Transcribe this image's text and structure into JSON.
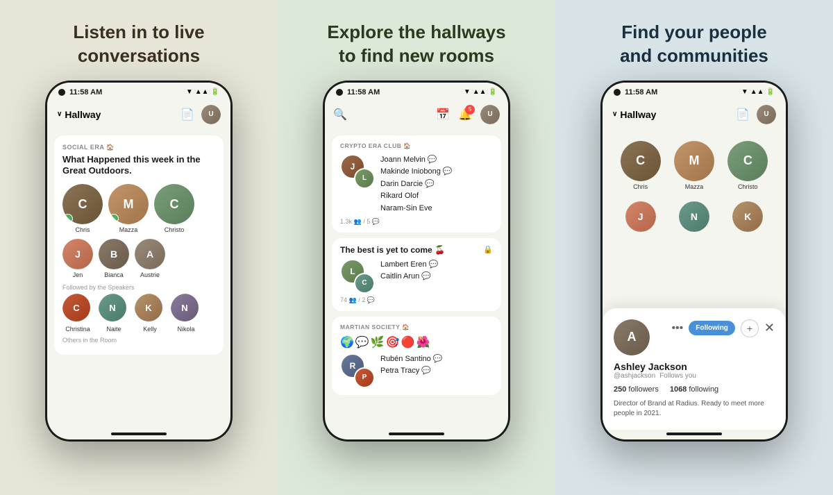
{
  "panel1": {
    "title": "Listen in to live\nconversations",
    "status_time": "11:58 AM",
    "hallway_label": "Hallway",
    "room1": {
      "club_label": "SOCIAL ERA 🏠",
      "title": "What Happened this week in the Great Outdoors.",
      "speakers": [
        {
          "name": "Chris",
          "badge": true,
          "color": "av-chris"
        },
        {
          "name": "Mazza",
          "badge": true,
          "color": "av-mazza"
        },
        {
          "name": "Christo",
          "badge": false,
          "color": "av-christo"
        }
      ],
      "followed_label": "Followed by the Speakers",
      "followers": [
        {
          "name": "Christina",
          "color": "av-christina"
        },
        {
          "name": "Naite",
          "color": "av-naite"
        },
        {
          "name": "Kelly",
          "color": "av-kelly"
        },
        {
          "name": "Nikola",
          "color": "av-nikola"
        }
      ],
      "others_label": "Others in the Room",
      "row2": [
        {
          "name": "Jen",
          "color": "av-jen"
        },
        {
          "name": "Bianca",
          "color": "av-bianca"
        },
        {
          "name": "Austrie",
          "color": "av-austrie"
        }
      ]
    }
  },
  "panel2": {
    "title": "Explore the hallways\nto find new rooms",
    "status_time": "11:58 AM",
    "search_placeholder": "Search",
    "notif_count": "5",
    "rooms": [
      {
        "club_label": "CRYPTO ERA CLUB 🏠",
        "speakers": [
          "Joann Melvin",
          "Makinde Iniobong",
          "Darin Darcie",
          "Rikard Olof",
          "Naram-Sin Eve"
        ],
        "meta": "1.3k 👥 / 5 💬"
      },
      {
        "title": "The best is yet to come 🍒",
        "locked": true,
        "speakers": [
          "Lambert Eren",
          "Caitlin Arun"
        ],
        "meta": "74 👥 / 2 💬"
      },
      {
        "club_label": "MARTIAN SOCIETY 🏠",
        "emoji_row": [
          "🌍",
          "💬",
          "🌿",
          "🎯",
          "🔴",
          "🌺"
        ],
        "speakers": [
          "Rubén Santino",
          "Petra Tracy"
        ],
        "meta": ""
      }
    ]
  },
  "panel3": {
    "title": "Find your people\nand communities",
    "status_time": "11:58 AM",
    "hallway_label": "Hallway",
    "speakers": [
      {
        "name": "Chris",
        "color": "av-chris"
      },
      {
        "name": "Mazza",
        "color": "av-mazza"
      },
      {
        "name": "Christo",
        "color": "av-christo"
      }
    ],
    "profile": {
      "name": "Ashley Jackson",
      "handle": "@ashjackson",
      "follows_you": "Follows you",
      "followers": "250",
      "followers_label": "followers",
      "following": "1068",
      "following_label": "following",
      "bio": "Director of Brand at Radius. Ready to meet more people in 2021.",
      "following_btn": "Following"
    }
  }
}
